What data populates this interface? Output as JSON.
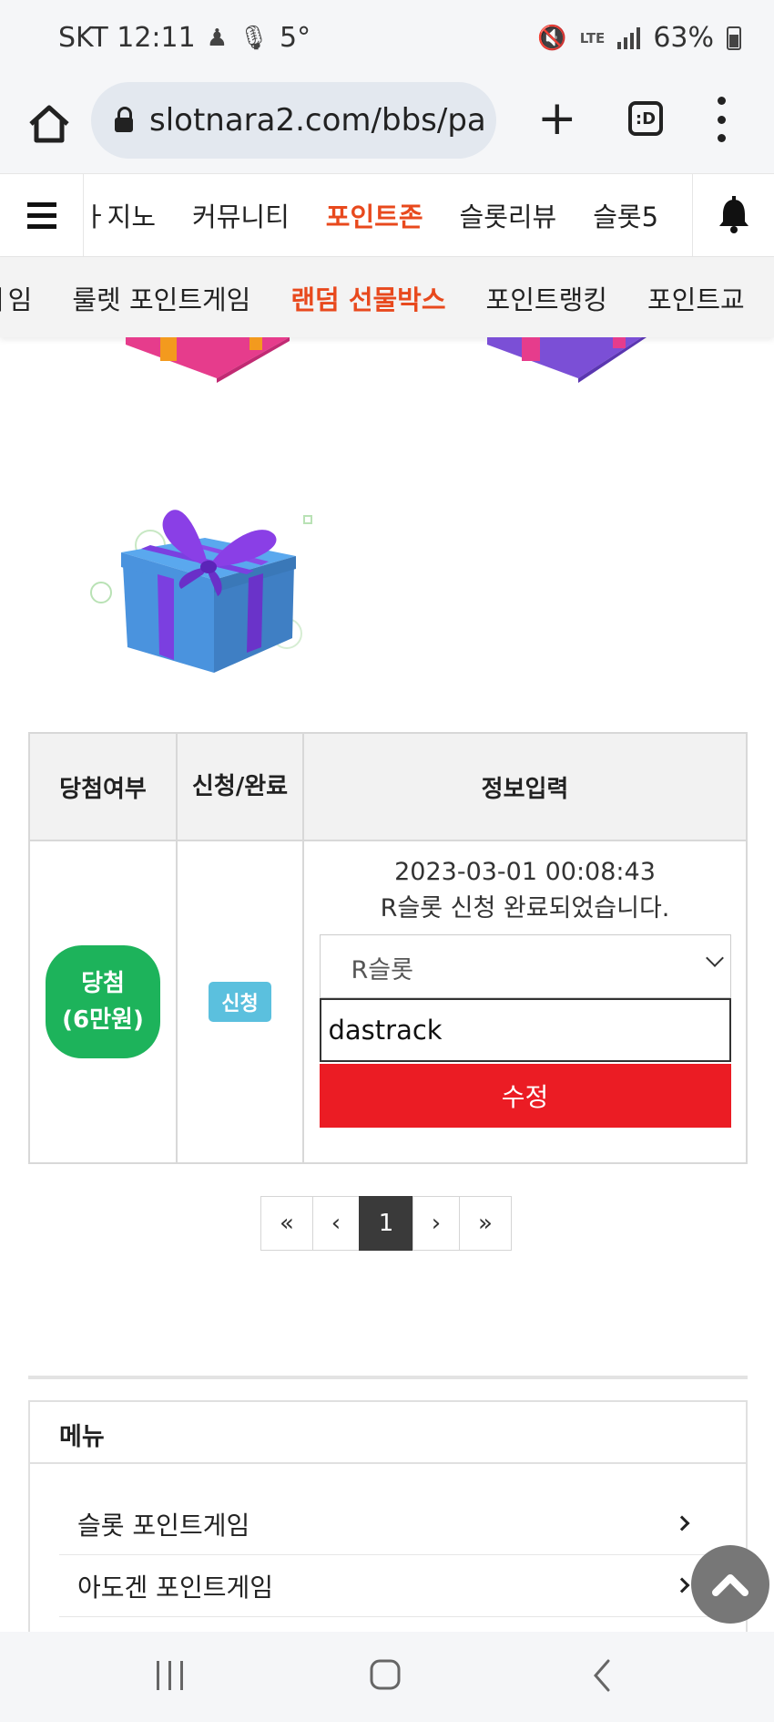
{
  "status_bar": {
    "carrier_time": "SKT 12:11",
    "temperature": "5°",
    "network": "LTE",
    "battery": "63%"
  },
  "browser": {
    "url": "slotnara2.com/bbs/pa",
    "tab_switcher_label": ":D"
  },
  "site_nav": {
    "items": [
      {
        "label": "카지노",
        "visible_label": "ㅏ지노"
      },
      {
        "label": "커뮤니티"
      },
      {
        "label": "포인트존",
        "active": true
      },
      {
        "label": "슬롯리뷰"
      },
      {
        "label": "슬롯5"
      }
    ]
  },
  "sub_nav": {
    "items": [
      {
        "label": "게임",
        "visible_label": "ㅔ임"
      },
      {
        "label": "룰렛 포인트게임"
      },
      {
        "label": "랜덤 선물박스",
        "active": true
      },
      {
        "label": "포인트랭킹"
      },
      {
        "label": "포인트교"
      }
    ]
  },
  "result_table": {
    "headers": [
      "당첨여부",
      "신청/완료",
      "정보입력"
    ],
    "row": {
      "win_badge_line1": "당첨",
      "win_badge_line2": "(6만원)",
      "status_badge": "신청",
      "datetime": "2023-03-01 00:08:43",
      "message": "R슬롯 신청 완료되었습니다.",
      "select_value": "R슬롯",
      "input_value": "dastrack",
      "submit_label": "수정"
    }
  },
  "pagination": {
    "first": "«",
    "prev": "‹",
    "current": "1",
    "next": "›",
    "last": "»"
  },
  "menu": {
    "title": "메뉴",
    "items": [
      {
        "label": "슬롯 포인트게임"
      },
      {
        "label": "아도겐 포인트게임"
      }
    ]
  },
  "colors": {
    "accent": "#e8491d",
    "win_green": "#1db35b",
    "apply_blue": "#5bc0de",
    "submit_red": "#eb1c24"
  }
}
